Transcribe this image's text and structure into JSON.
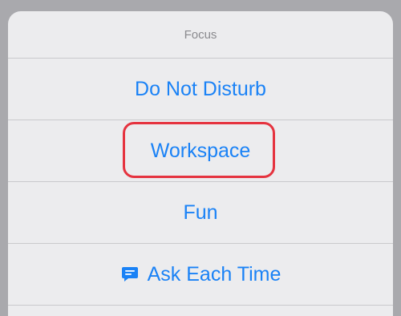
{
  "sheet": {
    "title": "Focus",
    "options": [
      {
        "label": "Do Not Disturb"
      },
      {
        "label": "Workspace"
      },
      {
        "label": "Fun"
      },
      {
        "label": "Ask Each Time",
        "icon": "message-icon"
      }
    ]
  },
  "colors": {
    "accent": "#1a82f6",
    "highlight_outline": "#e5333f",
    "sheet_background": "#ececee",
    "title_text": "#8a8a8e"
  }
}
